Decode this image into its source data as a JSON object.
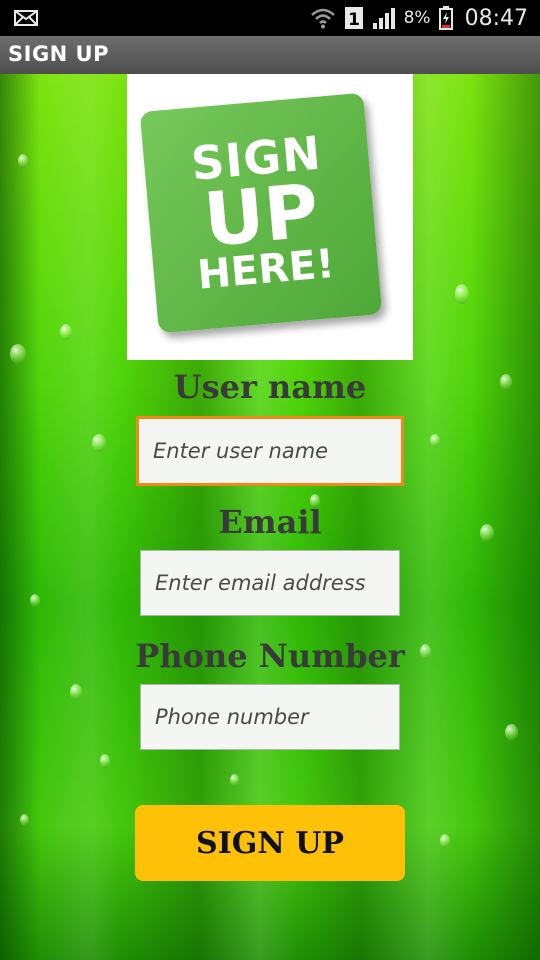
{
  "status_bar": {
    "battery_percent": "8%",
    "time": "08:47",
    "icons": [
      "mail-icon",
      "wifi-icon",
      "sim-1-icon",
      "signal-icon",
      "battery-charging-icon"
    ]
  },
  "action_bar": {
    "title": "SIGN UP"
  },
  "logo": {
    "line1": "SIGN",
    "line2": "UP",
    "line3": "HERE!",
    "icon": "sign-up-here-badge"
  },
  "form": {
    "username": {
      "label": "User name",
      "placeholder": "Enter user name",
      "value": ""
    },
    "email": {
      "label": "Email",
      "placeholder": "Enter email address",
      "value": ""
    },
    "phone": {
      "label": "Phone Number",
      "placeholder": "Phone number",
      "value": ""
    },
    "submit_label": "SIGN UP"
  },
  "colors": {
    "accent_button": "#ffc107",
    "focus_border": "#f08a14",
    "label_text": "#3a3a3a",
    "background_green": "#4fd40a"
  }
}
